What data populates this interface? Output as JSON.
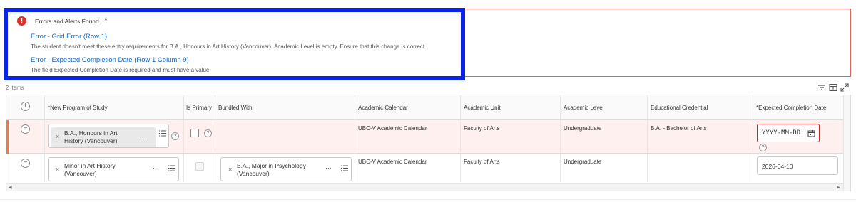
{
  "errors": {
    "title": "Errors and Alerts Found",
    "caret": "^",
    "icon": "error-circle-icon",
    "items": [
      {
        "link": "Error - Grid Error (Row 1)",
        "message": "The student doesn't meet these entry requirements for B.A., Honours in Art History (Vancouver): Academic Level is empty. Ensure that this change is correct."
      },
      {
        "link": "Error - Expected Completion Date (Row 1 Column 9)",
        "message": "The field Expected Completion Date is required and must have a value."
      }
    ]
  },
  "grid": {
    "item_count": "2 items",
    "headers": {
      "program": "*New Program of Study",
      "primary": "Is Primary",
      "bundled": "Bundled With",
      "calendar": "Academic Calendar",
      "unit": "Academic Unit",
      "level": "Academic Level",
      "credential": "Educational Credential",
      "completion": "*Expected Completion Date"
    },
    "rows": [
      {
        "program": "B.A., Honours in Art History (Vancouver)",
        "bundled": "",
        "calendar": "UBC-V Academic Calendar",
        "unit": "Faculty of Arts",
        "level": "Undergraduate",
        "credential": "B.A. - Bachelor of Arts",
        "completion_placeholder": "YYYY-MM-DD",
        "status": "error"
      },
      {
        "program": "Minor in Art History (Vancouver)",
        "bundled": "B.A., Major in Psychology (Vancouver)",
        "calendar": "UBC-V Academic Calendar",
        "unit": "Faculty of Arts",
        "level": "Undergraduate",
        "credential": "",
        "completion": "2026-04-10",
        "status": "ok"
      }
    ]
  },
  "colors": {
    "error": "#d9322c",
    "link": "#1368c4",
    "highlight_border": "#0a24e6",
    "row_error_bg": "#fdf0ee",
    "row_error_bar": "#ef7b3f"
  }
}
